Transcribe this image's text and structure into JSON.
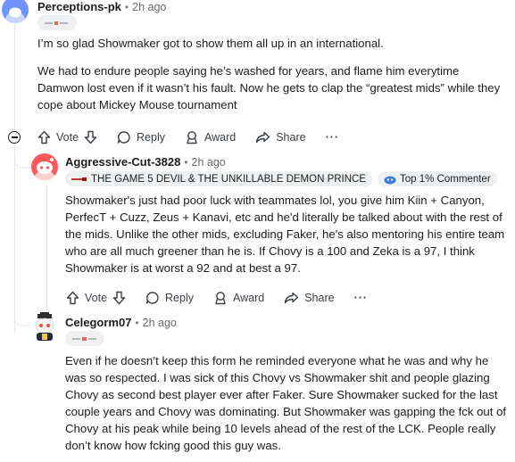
{
  "comments": [
    {
      "username": "Perceptions-pk",
      "separator": "•",
      "time": "2h ago",
      "body": [
        "I’m so glad Showmaker got to show them all up in an international.",
        "We had to endure people saying he’s washed for years, and flame him everytime Damwon lost even if it wasn’t his fault. Now he gets to clap the “greatest mids” while they cope about Mickey Mouse tournament"
      ]
    },
    {
      "username": "Aggressive-Cut-3828",
      "separator": "•",
      "time": "2h ago",
      "flair_text": "THE GAME 5 DEVIL & THE UNKILLABLE DEMON PRINCE",
      "badge_text": "Top 1% Commenter",
      "body": [
        "Showmaker's just had poor luck with teammates lol, you give him Kiin + Canyon, PerfecT + Cuzz, Zeus + Kanavi, etc and he'd literally be talked about with the rest of the mids. Unlike the other mids, excluding Faker, he's also mentoring his entire team who are all much greener than he is. If Chovy is a 100 and Zeka is a 97, I think Showmaker is at worst a 92 and at best a 97."
      ]
    },
    {
      "username": "Celegorm07",
      "separator": "•",
      "time": "2h ago",
      "body": [
        "Even if he doesn’t keep this form he reminded everyone what he was and why he was so respected. I was sick of this Chovy vs Showmaker shit and people glazing Chovy as second best player ever after Faker. Sure Showmaker sucked for the last couple years and Chovy was dominating. But Showmaker was gapping the fck out of Chovy at his peak while being 10 levels ahead of the rest of the LCK. People really don’t know how fcking good this guy was."
      ]
    }
  ],
  "actions": {
    "vote": "Vote",
    "reply": "Reply",
    "award": "Award",
    "share": "Share",
    "more": "···"
  },
  "colors": {
    "text": "#1c1c1c",
    "muted": "#6a6a6a",
    "flair_bg": "#eef0f2",
    "thread_line": "#e2e5e8",
    "avatar1": "#7193ff",
    "avatar2": "#ff585b"
  }
}
